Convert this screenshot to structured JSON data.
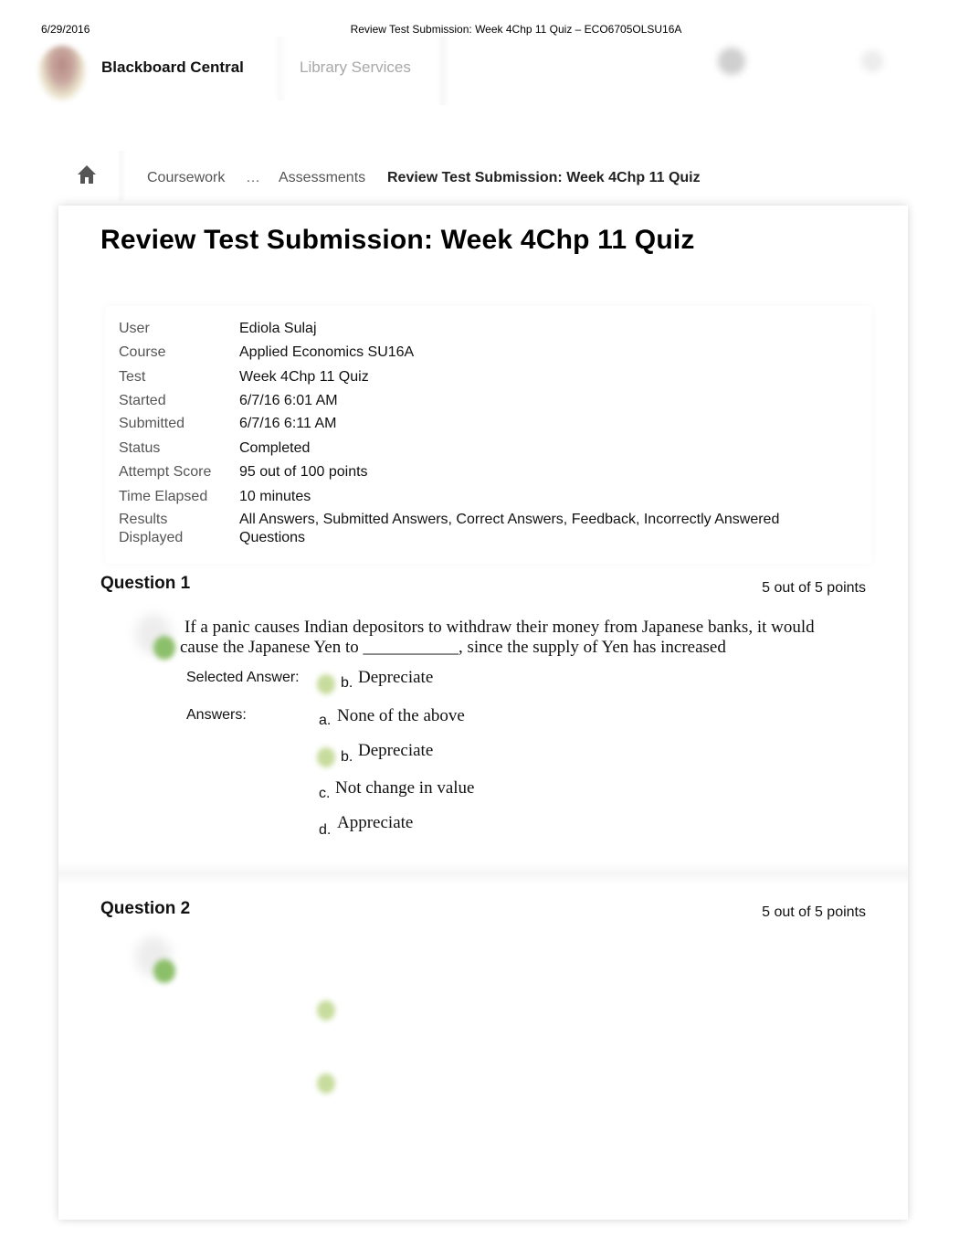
{
  "print_header": {
    "date": "6/29/2016",
    "title": "Review Test Submission: Week 4Chp 11 Quiz – ECO6705OLSU16A"
  },
  "topbar": {
    "brand": "Blackboard Central",
    "library": "Library Services"
  },
  "breadcrumb": {
    "home_icon": "home-icon",
    "items": [
      "Coursework",
      "…",
      "Assessments"
    ],
    "current": "Review Test Submission: Week 4Chp 11 Quiz"
  },
  "page_title": "Review Test Submission: Week 4Chp 11 Quiz",
  "details": [
    {
      "label": "User",
      "value": "Ediola Sulaj"
    },
    {
      "label": "Course",
      "value": "Applied Economics  SU16A"
    },
    {
      "label": "Test",
      "value": "Week 4Chp 11 Quiz"
    },
    {
      "label": "Started",
      "value": "6/7/16 6:01 AM"
    },
    {
      "label": "Submitted",
      "value": "6/7/16 6:11 AM"
    },
    {
      "label": "Status",
      "value": "Completed"
    },
    {
      "label": "Attempt Score",
      "value": "95 out of 100 points"
    },
    {
      "label": "Time Elapsed",
      "value": "10 minutes"
    },
    {
      "label": "Results Displayed",
      "label_line1": "Results",
      "label_line2": "Displayed",
      "value_line1": "All Answers, Submitted Answers, Correct Answers, Feedback, Incorrectly Answered",
      "value_line2": "Questions"
    }
  ],
  "questions": [
    {
      "title": "Question 1",
      "points": "5 out of 5 points",
      "status_icon": "correct-check-icon",
      "text_line1": "If a panic causes Indian depositors to withdraw their money from Japanese banks, it would",
      "text_line2": "cause the Japanese Yen to ___________, since the supply of Yen has increased",
      "selected_label": "Selected Answer:",
      "selected": {
        "letter": "b.",
        "text": "Depreciate"
      },
      "answers_label": "Answers:",
      "answers": [
        {
          "letter": "a.",
          "text": "None of the above",
          "correct": false
        },
        {
          "letter": "b.",
          "text": "Depreciate",
          "correct": true
        },
        {
          "letter": "c.",
          "text": "Not change in value",
          "correct": false
        },
        {
          "letter": "d.",
          "text": "Appreciate",
          "correct": false
        }
      ]
    },
    {
      "title": "Question 2",
      "points": "5 out of 5 points",
      "status_icon": "correct-check-icon"
    }
  ]
}
